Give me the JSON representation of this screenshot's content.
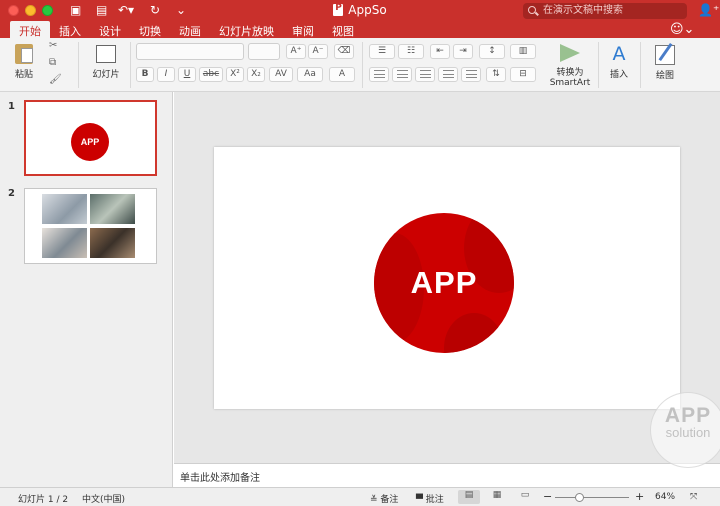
{
  "window": {
    "title": "AppSo"
  },
  "search": {
    "placeholder": "在演示文稿中搜索"
  },
  "tabs": [
    {
      "label": "开始",
      "active": true
    },
    {
      "label": "插入"
    },
    {
      "label": "设计"
    },
    {
      "label": "切换"
    },
    {
      "label": "动画"
    },
    {
      "label": "幻灯片放映"
    },
    {
      "label": "审阅"
    },
    {
      "label": "视图"
    }
  ],
  "ribbon": {
    "paste_label": "粘贴",
    "slide_label": "幻灯片",
    "convert_label": "转换为",
    "convert_label2": "SmartArt",
    "insert_label": "插入",
    "draw_label": "绘图",
    "format": {
      "bold": "B",
      "italic": "I",
      "underline": "U",
      "strike": "abc",
      "superscript": "X²",
      "subscript": "X₂",
      "font_a": "A"
    }
  },
  "slides": [
    {
      "number": "1",
      "thumb_text": "APP"
    },
    {
      "number": "2"
    }
  ],
  "slide": {
    "logo_text": "APP"
  },
  "notes": {
    "placeholder": "单击此处添加备注"
  },
  "watermark": {
    "line1": "APP",
    "line2": "solution"
  },
  "status": {
    "slide_counter": "幻灯片 1 / 2",
    "language": "中文(中国)",
    "notes_label": "备注",
    "comments_label": "批注",
    "zoom": "64%"
  },
  "colors": {
    "accent": "#c9302c",
    "logo_red": "#cc0000"
  },
  "icons": [
    "search-icon",
    "add-user-icon",
    "smiley-icon",
    "paste-icon",
    "cut-icon",
    "copy-icon",
    "format-painter-icon",
    "new-slide-icon",
    "convert-smartart-icon",
    "insert-icon",
    "draw-icon",
    "notes-icon",
    "comments-icon",
    "normal-view-icon",
    "slide-sorter-icon",
    "reading-view-icon"
  ]
}
